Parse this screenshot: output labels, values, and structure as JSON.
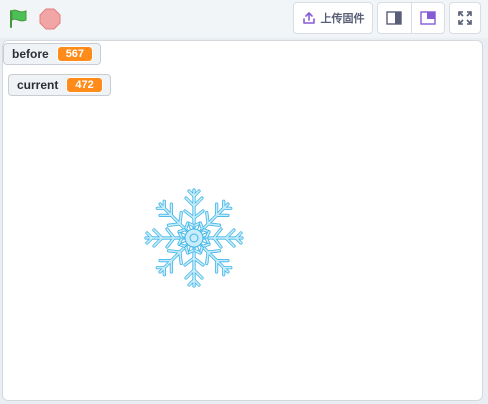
{
  "toolbar": {
    "upload_label": "上传固件",
    "flag_icon": "green-flag-icon",
    "stop_icon": "stop-icon",
    "upload_icon": "upload-icon",
    "layout_small_icon": "small-stage-icon",
    "layout_large_icon": "large-stage-icon",
    "fullscreen_icon": "fullscreen-icon"
  },
  "monitors": [
    {
      "label": "before",
      "value": "567"
    },
    {
      "label": "current",
      "value": "472"
    }
  ],
  "sprite": {
    "name": "snowflake"
  },
  "colors": {
    "flag": "#4cbf56",
    "stop": "#ec9c9c",
    "accent": "#855cd6",
    "monitor_value": "#ff8c1a",
    "snowflake_fill": "#c9ecfb",
    "snowflake_stroke": "#3fb6e8"
  }
}
